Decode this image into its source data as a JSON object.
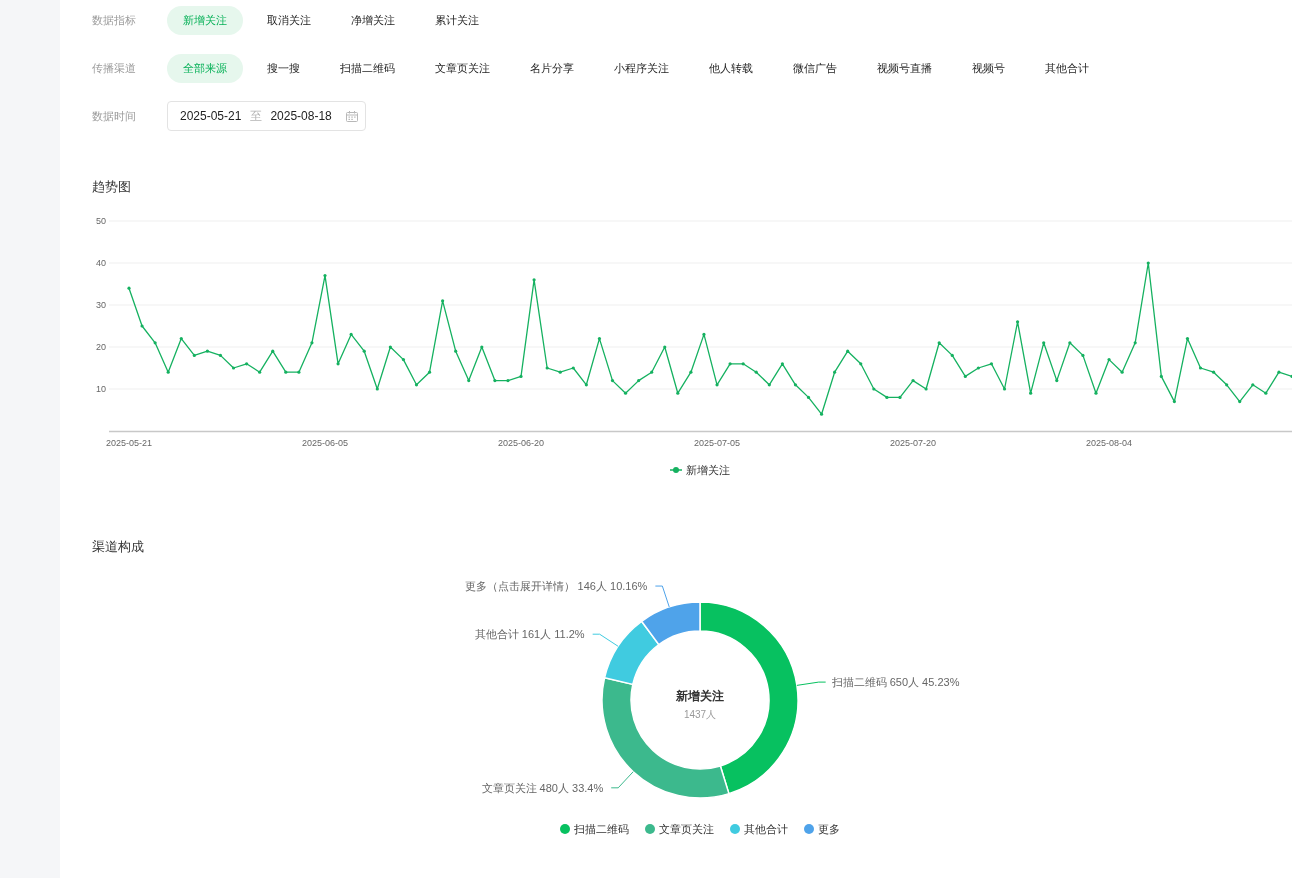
{
  "filters": [
    {
      "kind": "chips",
      "label": "数据指标",
      "options": [
        {
          "label": "新增关注",
          "selected": true
        },
        {
          "label": "取消关注",
          "selected": false
        },
        {
          "label": "净增关注",
          "selected": false
        },
        {
          "label": "累计关注",
          "selected": false
        }
      ]
    },
    {
      "kind": "chips",
      "label": "传播渠道",
      "options": [
        {
          "label": "全部来源",
          "selected": true
        },
        {
          "label": "搜一搜",
          "selected": false
        },
        {
          "label": "扫描二维码",
          "selected": false
        },
        {
          "label": "文章页关注",
          "selected": false
        },
        {
          "label": "名片分享",
          "selected": false
        },
        {
          "label": "小程序关注",
          "selected": false
        },
        {
          "label": "他人转载",
          "selected": false
        },
        {
          "label": "微信广告",
          "selected": false
        },
        {
          "label": "视频号直播",
          "selected": false
        },
        {
          "label": "视频号",
          "selected": false
        },
        {
          "label": "其他合计",
          "selected": false
        }
      ]
    },
    {
      "kind": "date_range",
      "label": "数据时间",
      "start": "2025-05-21",
      "separator": "至",
      "end": "2025-08-18"
    }
  ],
  "trend": {
    "title": "趋势图",
    "x_axis_labels": [
      "2025-05-21",
      "2025-06-05",
      "2025-06-20",
      "2025-07-05",
      "2025-07-20",
      "2025-08-04"
    ],
    "chart_data": {
      "type": "line",
      "series": [
        {
          "name": "新增关注",
          "color": "#15b160",
          "values": [
            34,
            25,
            21,
            14,
            22,
            18,
            19,
            18,
            15,
            16,
            14,
            19,
            14,
            14,
            21,
            37,
            16,
            23,
            19,
            10,
            20,
            17,
            11,
            14,
            31,
            19,
            12,
            20,
            12,
            12,
            13,
            36,
            15,
            14,
            15,
            11,
            22,
            12,
            9,
            12,
            14,
            20,
            9,
            14,
            23,
            11,
            16,
            16,
            14,
            11,
            16,
            11,
            8,
            4,
            14,
            19,
            16,
            10,
            8,
            8,
            12,
            10,
            21,
            18,
            13,
            15,
            16,
            10,
            26,
            9,
            21,
            12,
            21,
            18,
            9,
            17,
            14,
            21,
            40,
            13,
            7,
            22,
            15,
            14,
            11,
            7,
            11,
            9,
            14,
            13
          ]
        }
      ],
      "ylim": [
        0,
        50
      ],
      "yticks": [
        10,
        20,
        30,
        40,
        50
      ],
      "grid": true
    }
  },
  "channels": {
    "title": "渠道构成",
    "center_title": "新增关注",
    "center_total": "1437人",
    "chart_data": {
      "type": "donut",
      "categories": [
        "扫描二维码",
        "文章页关注",
        "其他合计",
        "更多"
      ],
      "values": [
        650,
        480,
        161,
        146
      ],
      "colors": [
        "#07c160",
        "#3cb98d",
        "#40cbe0",
        "#4fa3ea"
      ],
      "value_labels": [
        "扫描二维码 650人 45.23%",
        "文章页关注 480人 33.4%",
        "其他合计 161人 11.2%",
        "更多（点击展开详情） 146人 10.16%"
      ]
    }
  }
}
